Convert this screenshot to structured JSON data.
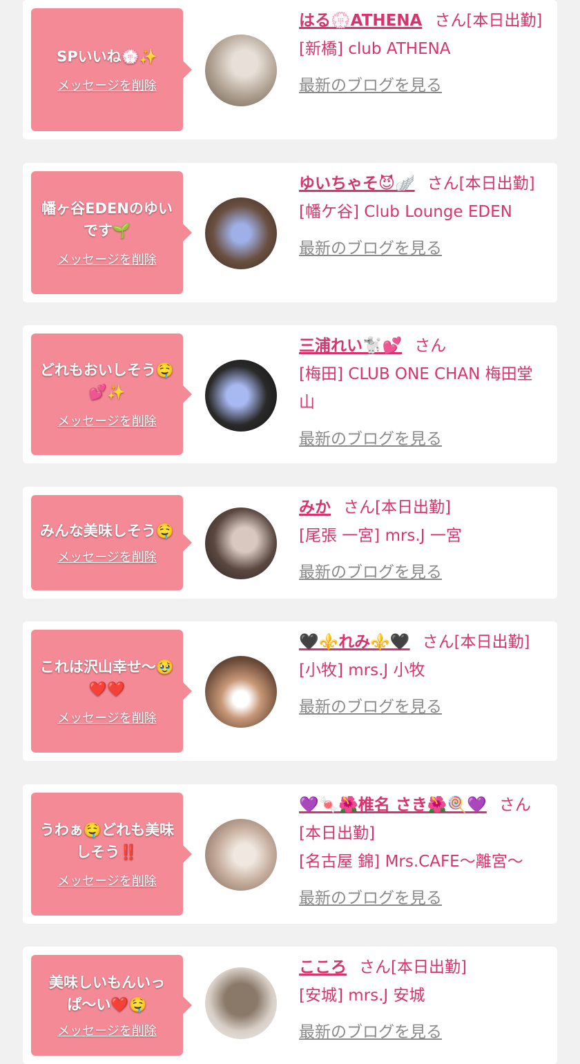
{
  "messages": [
    {
      "bubble_text": "SPいいね💮✨",
      "delete_label": "メッセージを削除",
      "name": "はる💮ATHENA",
      "suffix": "さん[本日出勤]",
      "shop": "[新橋] club ATHENA",
      "blog_label": "最新のブログを見る",
      "avatar_colors": [
        "#a99a8a",
        "#e8e0d8"
      ]
    },
    {
      "bubble_text": "幡ヶ谷EDENのゆいです🌱",
      "delete_label": "メッセージを削除",
      "name": "ゆいちゃそ😈🪽",
      "suffix": "さん[本日出勤]",
      "shop": "[幡ケ谷] Club Lounge EDEN",
      "blog_label": "最新のブログを見る",
      "avatar_colors": [
        "#6a5040",
        "#9fb0e8"
      ]
    },
    {
      "bubble_text": "どれもおいしそう🤤💕✨",
      "delete_label": "メッセージを削除",
      "name": "三浦れい🐩💕",
      "suffix": "さん",
      "shop": "[梅田] CLUB ONE CHAN 梅田堂山",
      "blog_label": "最新のブログを見る",
      "avatar_colors": [
        "#1a1a1a",
        "#a8b8f0"
      ]
    },
    {
      "bubble_text": "みんな美味しそう🤤",
      "delete_label": "メッセージを削除",
      "name": "みか",
      "suffix": "さん[本日出勤]",
      "shop": "[尾張 一宮] mrs.J 一宮",
      "blog_label": "最新のブログを見る",
      "avatar_colors": [
        "#3a3030",
        "#d8c8c0"
      ]
    },
    {
      "bubble_text": "これは沢山幸せ〜🥹❤️❤️",
      "delete_label": "メッセージを削除",
      "name": "🖤⚜️れみ⚜️🖤",
      "suffix": "さん[本日出勤]",
      "shop": "[小牧] mrs.J 小牧",
      "blog_label": "最新のブログを見る",
      "avatar_colors": [
        "#6a4a38",
        "#e8d0c0"
      ]
    },
    {
      "bubble_text": "うわぁ🤤どれも美味しそう‼️",
      "delete_label": "メッセージを削除",
      "name": "💜🍬🌺椎名 さき🌺🍭💜",
      "suffix": "さん[本日出勤]",
      "shop": "[名古屋 錦] Mrs.CAFE〜離宮〜",
      "blog_label": "最新のブログを見る",
      "avatar_colors": [
        "#c8b0a0",
        "#f0e8e0"
      ]
    },
    {
      "bubble_text": "美味しいもんいっぱ〜い❤️🤤",
      "delete_label": "メッセージを削除",
      "name": "こころ",
      "suffix": "さん[本日出勤]",
      "shop": "[安城] mrs.J 安城",
      "blog_label": "最新のブログを見る",
      "avatar_colors": [
        "#8a7868",
        "#d8d0c8"
      ]
    }
  ]
}
